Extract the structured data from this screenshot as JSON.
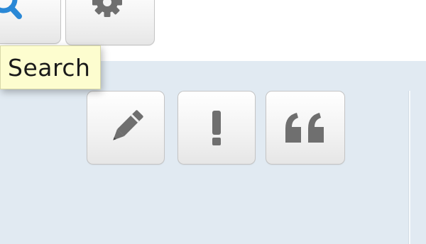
{
  "toolbar": {
    "buttons": [
      {
        "id": "search",
        "icon": "search-icon",
        "icon_color": "#2a88d6"
      },
      {
        "id": "settings",
        "icon": "gear-icon",
        "icon_color": "#6f6f6f"
      }
    ]
  },
  "tooltip": {
    "text": "Search"
  },
  "editor_actions": {
    "buttons": [
      {
        "id": "edit",
        "icon": "pencil-icon",
        "icon_color": "#6f6f6f"
      },
      {
        "id": "alert",
        "icon": "exclamation-icon",
        "icon_color": "#6f6f6f"
      },
      {
        "id": "quote",
        "icon": "quote-icon",
        "icon_color": "#6f6f6f"
      }
    ]
  },
  "colors": {
    "panel_background": "#e1eaf2",
    "tooltip_background": "#fdfdcf",
    "accent": "#2a88d6",
    "icon_gray": "#6f6f6f"
  }
}
